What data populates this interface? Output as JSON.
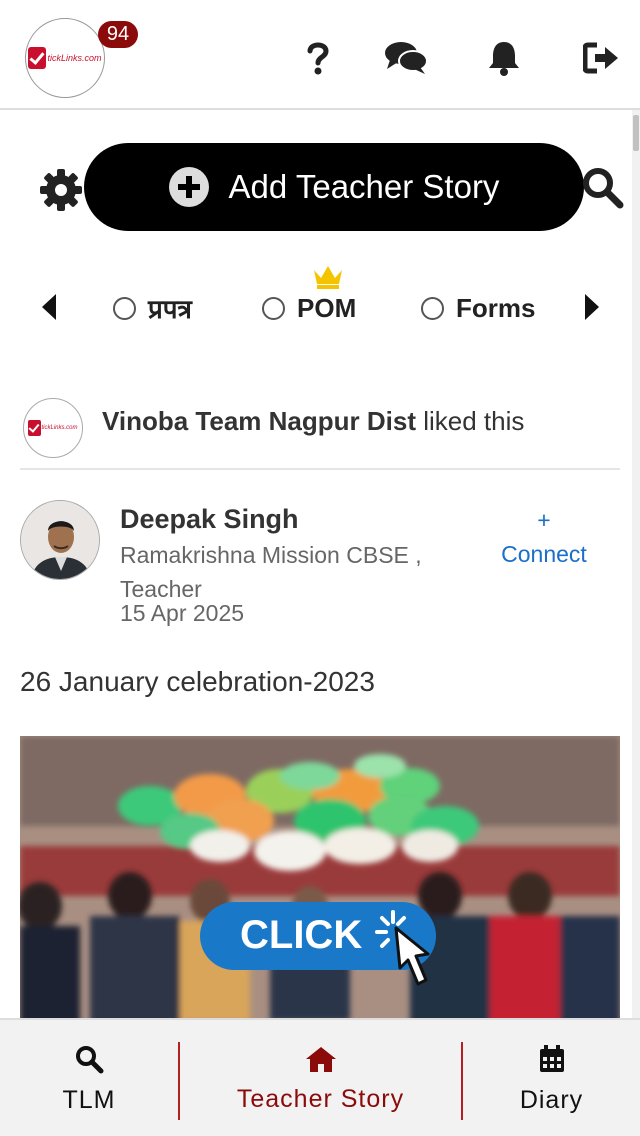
{
  "header": {
    "logo_text": "tickLinks.com",
    "notification_count": "94",
    "icons": [
      "help-icon",
      "chat-icon",
      "bell-icon",
      "logout-icon"
    ]
  },
  "story_bar": {
    "add_label": "Add Teacher Story"
  },
  "filters": [
    {
      "label": "प्रपत्र"
    },
    {
      "label": "POM"
    },
    {
      "label": "Forms"
    }
  ],
  "activity": {
    "actor": "Vinoba Team Nagpur Dist",
    "action": " liked this"
  },
  "post": {
    "author": "Deepak Singh",
    "school": "Ramakrishna Mission CBSE ,",
    "role": "Teacher",
    "date": "15 Apr 2025",
    "connect_plus": "+",
    "connect_label": "Connect",
    "title": "26 January celebration-2023",
    "image_overlay_text": "CLICK"
  },
  "bottom_nav": [
    {
      "label": "TLM",
      "icon": "search-icon"
    },
    {
      "label": "Teacher Story",
      "icon": "home-icon"
    },
    {
      "label": "Diary",
      "icon": "calendar-icon"
    }
  ],
  "colors": {
    "accent": "#8b0a0a",
    "link": "#1a6fc9",
    "button_bg": "#000000"
  }
}
